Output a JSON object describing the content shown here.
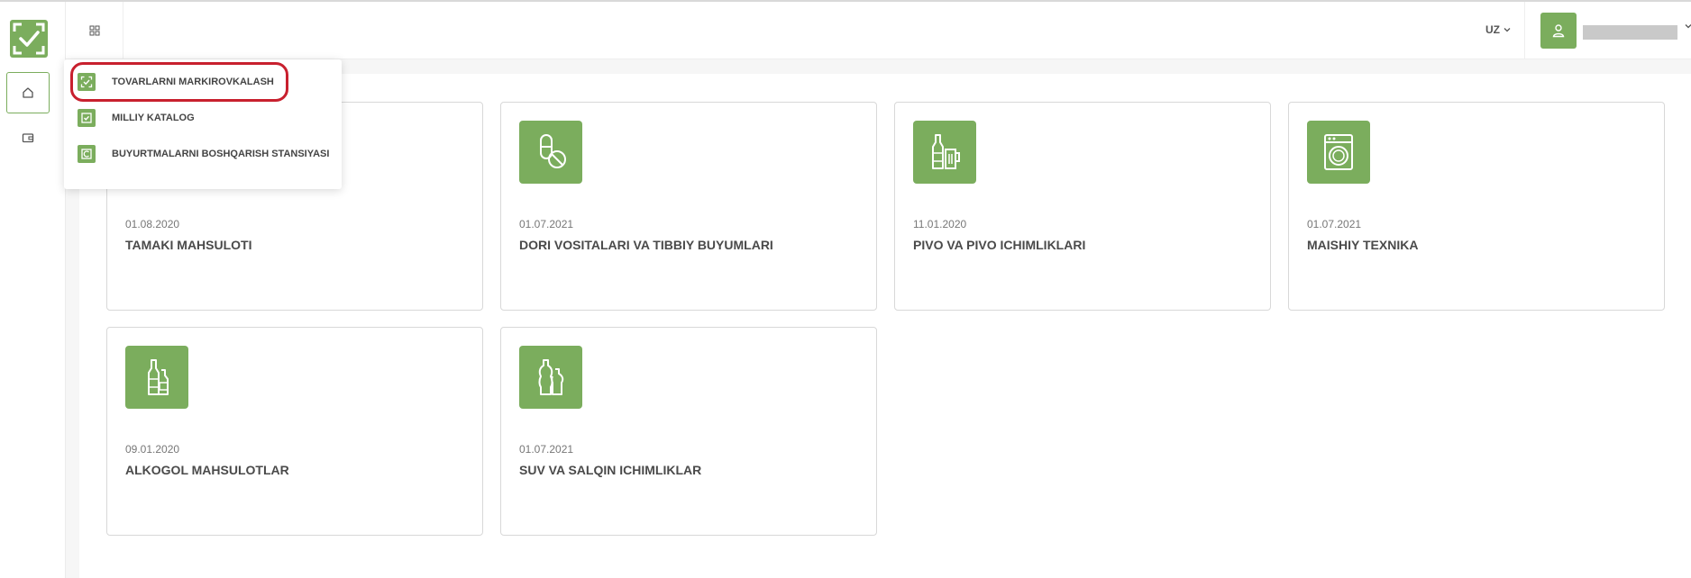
{
  "header": {
    "language": "UZ"
  },
  "menu": {
    "items": [
      {
        "label": "TOVARLARNI MARKIROVKALASH",
        "icon": "scan-check-icon"
      },
      {
        "label": "MILLIY KATALOG",
        "icon": "checkbox-icon"
      },
      {
        "label": "BUYURTMALARNI BOSHQARISH STANSIYASI",
        "icon": "station-icon"
      }
    ]
  },
  "cards": [
    {
      "date": "01.08.2020",
      "title": "TAMAKI MAHSULOTI",
      "icon": "tobacco-icon"
    },
    {
      "date": "01.07.2021",
      "title": "DORI VOSITALARI VA TIBBIY BUYUMLARI",
      "icon": "pills-icon"
    },
    {
      "date": "11.01.2020",
      "title": "PIVO VA PIVO ICHIMLIKLARI",
      "icon": "beer-icon"
    },
    {
      "date": "01.07.2021",
      "title": "MAISHIY TEXNIKA",
      "icon": "washing-machine-icon"
    },
    {
      "date": "09.01.2020",
      "title": "ALKOGOL MAHSULOTLAR",
      "icon": "alcohol-bottles-icon"
    },
    {
      "date": "01.07.2021",
      "title": "SUV VA SALQIN ICHIMLIKLAR",
      "icon": "water-bottles-icon"
    }
  ],
  "colors": {
    "accent": "#7bad5d",
    "highlight": "#c8202e"
  }
}
